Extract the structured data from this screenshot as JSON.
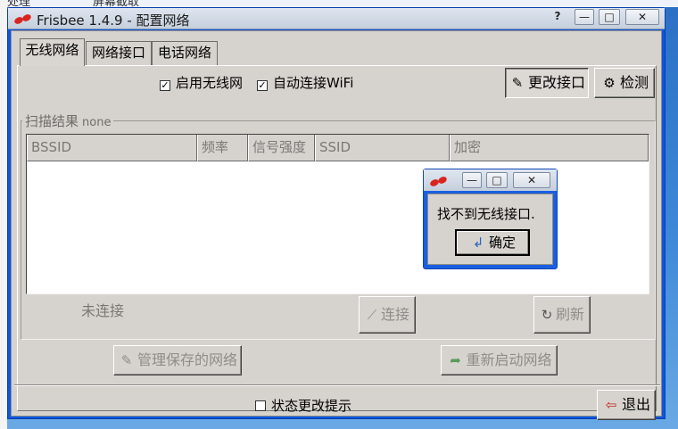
{
  "desktop": {
    "top_texts": [
      "处理",
      "屏幕截取"
    ]
  },
  "window": {
    "title": "Frisbee  1.4.9 - 配置网络",
    "controls": {
      "help": "?",
      "minimize": "—",
      "maximize": "□",
      "close": "✕"
    }
  },
  "tabs": [
    {
      "label": "无线网络",
      "active": true
    },
    {
      "label": "网络接口",
      "active": false
    },
    {
      "label": "电话网络",
      "active": false
    }
  ],
  "wireless": {
    "enable_wireless": {
      "label": "启用无线网",
      "checked": true
    },
    "auto_connect": {
      "label": "自动连接WiFi",
      "checked": true
    },
    "change_interface_label": "更改接口",
    "detect_label": "检测",
    "scan_results_label": "扫描结果",
    "scan_results_value": "none",
    "columns": [
      "BSSID",
      "频率",
      "信号强度",
      "SSID",
      "加密"
    ],
    "status": "未连接",
    "connect_label": "连接",
    "refresh_label": "刷新",
    "manage_saved_label": "管理保存的网络",
    "restart_network_label": "重新启动网络"
  },
  "footer": {
    "status_change_hint": {
      "label": "状态更改提示",
      "checked": false
    },
    "exit_label": "退出"
  },
  "dialog": {
    "message": "找不到无线接口.",
    "ok_label": "确定"
  },
  "colors": {
    "window_frame": "#0a56e0",
    "dialog_frame": "#1a5fe0",
    "client_bg": "#d6d3ce",
    "logo_red": "#d8261e"
  },
  "icons": {
    "app": "frisbee-logo",
    "change_interface": "wrench-icon",
    "detect": "gears-icon",
    "connect": "connect-icon",
    "refresh": "refresh-icon",
    "manage": "wrench-icon",
    "restart": "restart-arrow-icon",
    "exit": "exit-door-icon",
    "ok": "enter-arrow-icon"
  }
}
